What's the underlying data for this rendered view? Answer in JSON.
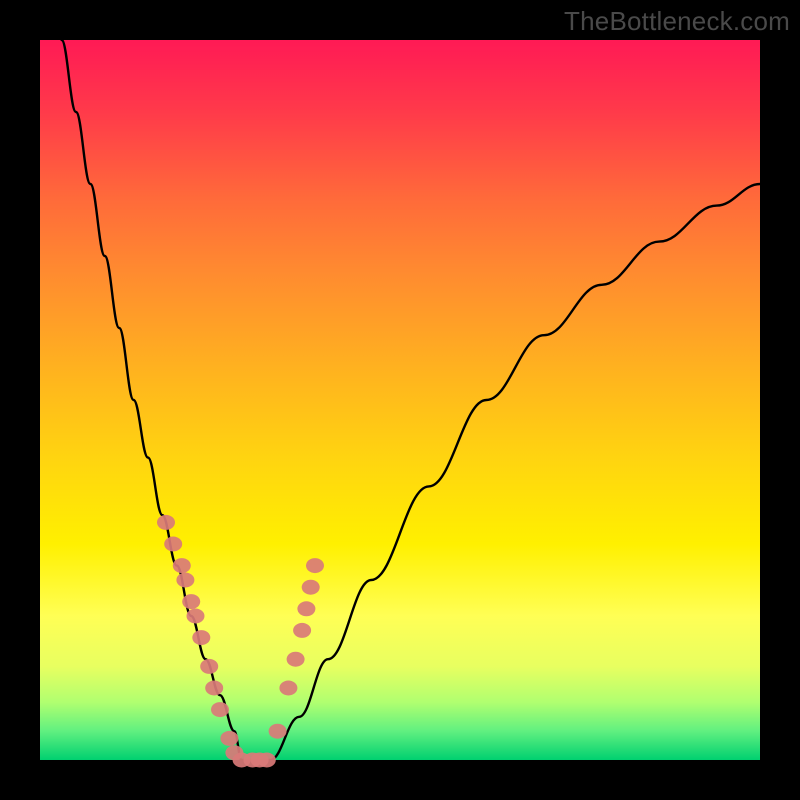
{
  "watermark": "TheBottleneck.com",
  "chart_data": {
    "type": "line",
    "title": "",
    "xlabel": "",
    "ylabel": "",
    "xlim": [
      0,
      100
    ],
    "ylim": [
      0,
      100
    ],
    "series": [
      {
        "name": "bottleneck-curve",
        "x": [
          3,
          5,
          7,
          9,
          11,
          13,
          15,
          17,
          19,
          21,
          23,
          25,
          27,
          28,
          32,
          36,
          40,
          46,
          54,
          62,
          70,
          78,
          86,
          94,
          100
        ],
        "y": [
          100,
          90,
          80,
          70,
          60,
          50,
          42,
          34,
          27,
          20,
          14,
          9,
          4,
          0,
          0,
          6,
          14,
          25,
          38,
          50,
          59,
          66,
          72,
          77,
          80
        ]
      }
    ],
    "markers": {
      "name": "highlight-points",
      "color": "#d97a78",
      "x": [
        17.5,
        18.5,
        19.7,
        20.2,
        21.0,
        21.6,
        22.4,
        23.5,
        24.2,
        25.0,
        26.3,
        27.0,
        28.0,
        29.5,
        30.5,
        31.5,
        33.0,
        34.5,
        35.5,
        36.4,
        37.0,
        37.6,
        38.2
      ],
      "y": [
        33,
        30,
        27,
        25,
        22,
        20,
        17,
        13,
        10,
        7,
        3,
        1,
        0,
        0,
        0,
        0,
        4,
        10,
        14,
        18,
        21,
        24,
        27
      ]
    }
  }
}
